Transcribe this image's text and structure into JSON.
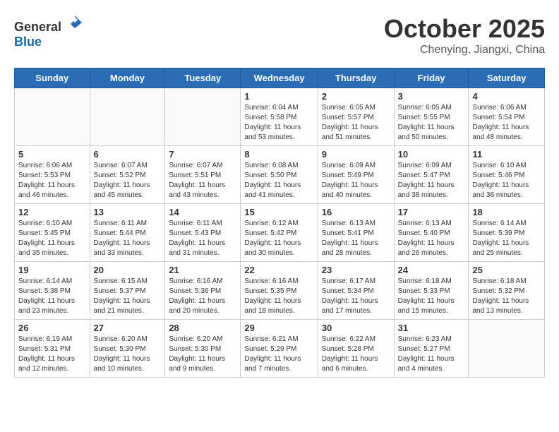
{
  "header": {
    "logo_general": "General",
    "logo_blue": "Blue",
    "month_year": "October 2025",
    "location": "Chenying, Jiangxi, China"
  },
  "days_of_week": [
    "Sunday",
    "Monday",
    "Tuesday",
    "Wednesday",
    "Thursday",
    "Friday",
    "Saturday"
  ],
  "weeks": [
    [
      {
        "day": "",
        "info": ""
      },
      {
        "day": "",
        "info": ""
      },
      {
        "day": "",
        "info": ""
      },
      {
        "day": "1",
        "info": "Sunrise: 6:04 AM\nSunset: 5:58 PM\nDaylight: 11 hours and 53 minutes."
      },
      {
        "day": "2",
        "info": "Sunrise: 6:05 AM\nSunset: 5:57 PM\nDaylight: 11 hours and 51 minutes."
      },
      {
        "day": "3",
        "info": "Sunrise: 6:05 AM\nSunset: 5:55 PM\nDaylight: 11 hours and 50 minutes."
      },
      {
        "day": "4",
        "info": "Sunrise: 6:06 AM\nSunset: 5:54 PM\nDaylight: 11 hours and 48 minutes."
      }
    ],
    [
      {
        "day": "5",
        "info": "Sunrise: 6:06 AM\nSunset: 5:53 PM\nDaylight: 11 hours and 46 minutes."
      },
      {
        "day": "6",
        "info": "Sunrise: 6:07 AM\nSunset: 5:52 PM\nDaylight: 11 hours and 45 minutes."
      },
      {
        "day": "7",
        "info": "Sunrise: 6:07 AM\nSunset: 5:51 PM\nDaylight: 11 hours and 43 minutes."
      },
      {
        "day": "8",
        "info": "Sunrise: 6:08 AM\nSunset: 5:50 PM\nDaylight: 11 hours and 41 minutes."
      },
      {
        "day": "9",
        "info": "Sunrise: 6:09 AM\nSunset: 5:49 PM\nDaylight: 11 hours and 40 minutes."
      },
      {
        "day": "10",
        "info": "Sunrise: 6:09 AM\nSunset: 5:47 PM\nDaylight: 11 hours and 38 minutes."
      },
      {
        "day": "11",
        "info": "Sunrise: 6:10 AM\nSunset: 5:46 PM\nDaylight: 11 hours and 36 minutes."
      }
    ],
    [
      {
        "day": "12",
        "info": "Sunrise: 6:10 AM\nSunset: 5:45 PM\nDaylight: 11 hours and 35 minutes."
      },
      {
        "day": "13",
        "info": "Sunrise: 6:11 AM\nSunset: 5:44 PM\nDaylight: 11 hours and 33 minutes."
      },
      {
        "day": "14",
        "info": "Sunrise: 6:11 AM\nSunset: 5:43 PM\nDaylight: 11 hours and 31 minutes."
      },
      {
        "day": "15",
        "info": "Sunrise: 6:12 AM\nSunset: 5:42 PM\nDaylight: 11 hours and 30 minutes."
      },
      {
        "day": "16",
        "info": "Sunrise: 6:13 AM\nSunset: 5:41 PM\nDaylight: 11 hours and 28 minutes."
      },
      {
        "day": "17",
        "info": "Sunrise: 6:13 AM\nSunset: 5:40 PM\nDaylight: 11 hours and 26 minutes."
      },
      {
        "day": "18",
        "info": "Sunrise: 6:14 AM\nSunset: 5:39 PM\nDaylight: 11 hours and 25 minutes."
      }
    ],
    [
      {
        "day": "19",
        "info": "Sunrise: 6:14 AM\nSunset: 5:38 PM\nDaylight: 11 hours and 23 minutes."
      },
      {
        "day": "20",
        "info": "Sunrise: 6:15 AM\nSunset: 5:37 PM\nDaylight: 11 hours and 21 minutes."
      },
      {
        "day": "21",
        "info": "Sunrise: 6:16 AM\nSunset: 5:36 PM\nDaylight: 11 hours and 20 minutes."
      },
      {
        "day": "22",
        "info": "Sunrise: 6:16 AM\nSunset: 5:35 PM\nDaylight: 11 hours and 18 minutes."
      },
      {
        "day": "23",
        "info": "Sunrise: 6:17 AM\nSunset: 5:34 PM\nDaylight: 11 hours and 17 minutes."
      },
      {
        "day": "24",
        "info": "Sunrise: 6:18 AM\nSunset: 5:33 PM\nDaylight: 11 hours and 15 minutes."
      },
      {
        "day": "25",
        "info": "Sunrise: 6:18 AM\nSunset: 5:32 PM\nDaylight: 11 hours and 13 minutes."
      }
    ],
    [
      {
        "day": "26",
        "info": "Sunrise: 6:19 AM\nSunset: 5:31 PM\nDaylight: 11 hours and 12 minutes."
      },
      {
        "day": "27",
        "info": "Sunrise: 6:20 AM\nSunset: 5:30 PM\nDaylight: 11 hours and 10 minutes."
      },
      {
        "day": "28",
        "info": "Sunrise: 6:20 AM\nSunset: 5:30 PM\nDaylight: 11 hours and 9 minutes."
      },
      {
        "day": "29",
        "info": "Sunrise: 6:21 AM\nSunset: 5:29 PM\nDaylight: 11 hours and 7 minutes."
      },
      {
        "day": "30",
        "info": "Sunrise: 6:22 AM\nSunset: 5:28 PM\nDaylight: 11 hours and 6 minutes."
      },
      {
        "day": "31",
        "info": "Sunrise: 6:23 AM\nSunset: 5:27 PM\nDaylight: 11 hours and 4 minutes."
      },
      {
        "day": "",
        "info": ""
      }
    ]
  ]
}
